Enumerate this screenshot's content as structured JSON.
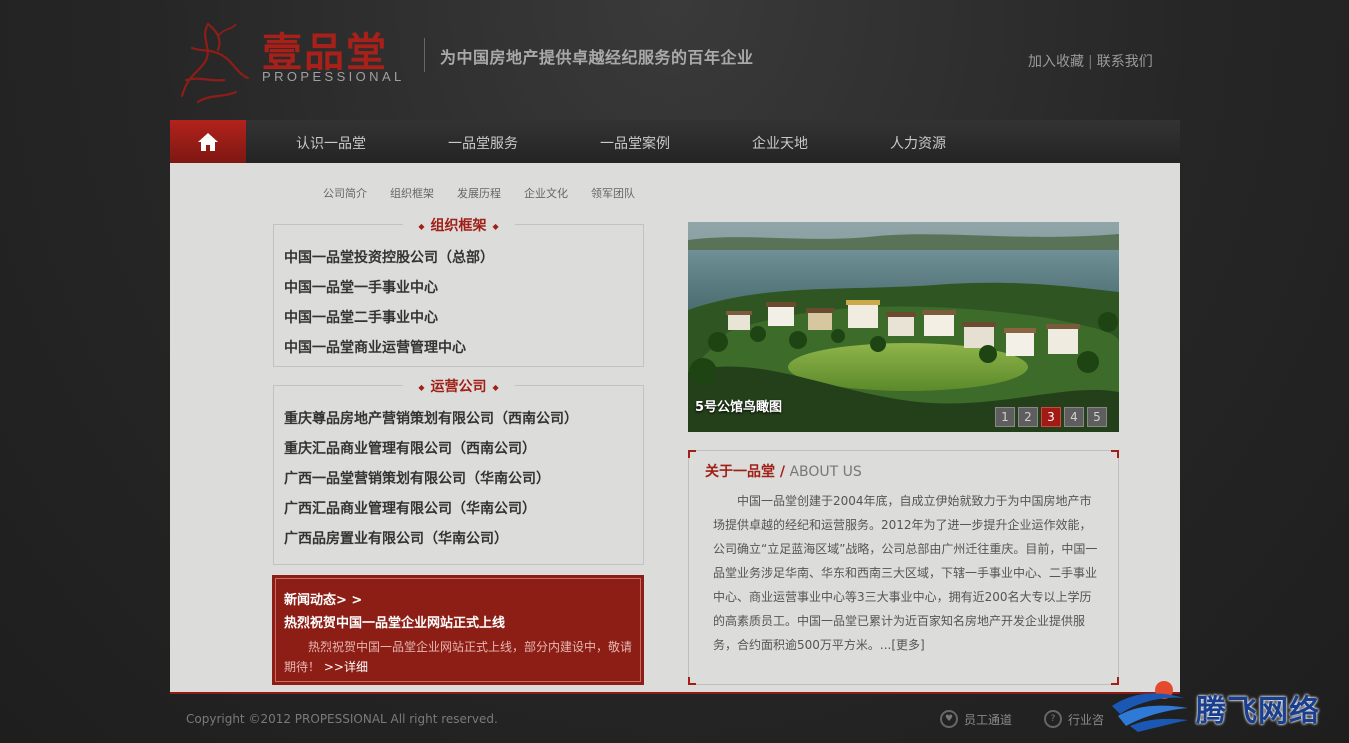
{
  "header": {
    "logo_cn": "壹品堂",
    "logo_en": "PROPESSIONAL",
    "slogan": "为中国房地产提供卓越经纪服务的百年企业",
    "links": [
      "加入收藏",
      "联系我们"
    ],
    "link_separator": "|"
  },
  "nav": {
    "items": [
      "认识一品堂",
      "一品堂服务",
      "一品堂案例",
      "企业天地",
      "人力资源"
    ],
    "active_color": "#a8201a"
  },
  "subnav": [
    "公司简介",
    "组织框架",
    "发展历程",
    "企业文化",
    "领军团队"
  ],
  "org": {
    "title": "组织框架",
    "items": [
      "中国一品堂投资控股公司（总部）",
      "中国一品堂一手事业中心",
      "中国一品堂二手事业中心",
      "中国一品堂商业运营管理中心"
    ]
  },
  "ops": {
    "title": "运营公司",
    "items": [
      "重庆尊品房地产营销策划有限公司（西南公司）",
      "重庆汇品商业管理有限公司（西南公司）",
      "广西一品堂营销策划有限公司（华南公司）",
      "广西汇品商业管理有限公司（华南公司）",
      "广西品房置业有限公司（华南公司）"
    ]
  },
  "news": {
    "heading": "新闻动态> >",
    "title": "热烈祝贺中国一品堂企业网站正式上线",
    "body": "热烈祝贺中国一品堂企业网站正式上线，部分内建设中，敬请期待！",
    "more": ">>详细"
  },
  "banner": {
    "caption": "5号公馆鸟瞰图",
    "pages": [
      "1",
      "2",
      "3",
      "4",
      "5"
    ],
    "active_page": "3"
  },
  "about": {
    "title_cn": "关于一品堂 /",
    "title_en": "ABOUT US",
    "body": "中国一品堂创建于2004年底，自成立伊始就致力于为中国房地产市场提供卓越的经纪和运营服务。2012年为了进一步提升企业运作效能，公司确立“立足蓝海区域”战略，公司总部由广州迁往重庆。目前，中国一品堂业务涉足华南、华东和西南三大区域，下辖一手事业中心、二手事业中心、商业运营事业中心等3三大事业中心，拥有近200名大专以上学历的高素质员工。中国一品堂已累计为近百家知名房地产开发企业提供服务，合约面积逾500万平方米。",
    "more": "...[更多]"
  },
  "footer": {
    "copyright": "Copyright ©2012 PROPESSIONAL All right reserved.",
    "links": [
      "员工通道",
      "行业咨"
    ]
  },
  "watermark": {
    "text": "腾飞网络"
  }
}
